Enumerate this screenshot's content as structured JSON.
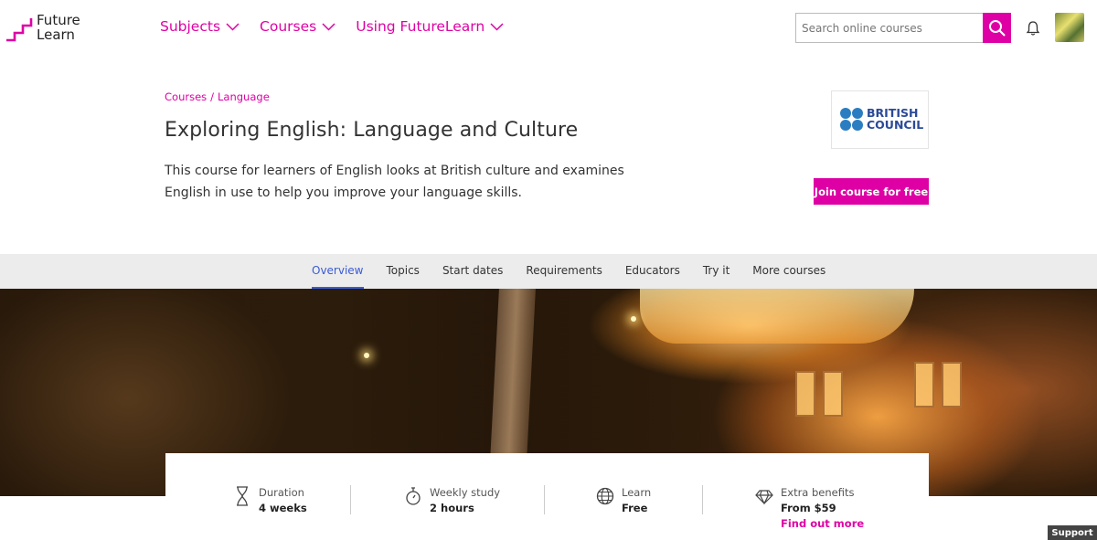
{
  "header": {
    "logo_line1": "Future",
    "logo_line2": "Learn",
    "nav": [
      {
        "label": "Subjects"
      },
      {
        "label": "Courses"
      },
      {
        "label": "Using FutureLearn"
      }
    ],
    "search_placeholder": "Search online courses",
    "accent_color": "#de00a5"
  },
  "course": {
    "breadcrumb": [
      "Courses",
      "/",
      "Language"
    ],
    "title": "Exploring English: Language and Culture",
    "description": "This course for learners of English looks at British culture and examines English in use to help you improve your language skills.",
    "partner_line1": "BRITISH",
    "partner_line2": "COUNCIL",
    "join_label": "Join course for free"
  },
  "tabs": [
    {
      "label": "Overview",
      "active": true
    },
    {
      "label": "Topics"
    },
    {
      "label": "Start dates"
    },
    {
      "label": "Requirements"
    },
    {
      "label": "Educators"
    },
    {
      "label": "Try it"
    },
    {
      "label": "More courses"
    }
  ],
  "info": {
    "duration": {
      "label": "Duration",
      "value": "4 weeks",
      "icon": "hourglass-icon"
    },
    "weekly": {
      "label": "Weekly study",
      "value": "2 hours",
      "icon": "stopwatch-icon"
    },
    "learn": {
      "label": "Learn",
      "value": "Free",
      "icon": "globe-icon"
    },
    "extra": {
      "label": "Extra benefits",
      "value": "From $59",
      "link": "Find out more",
      "icon": "diamond-icon"
    }
  },
  "support_label": "Support"
}
